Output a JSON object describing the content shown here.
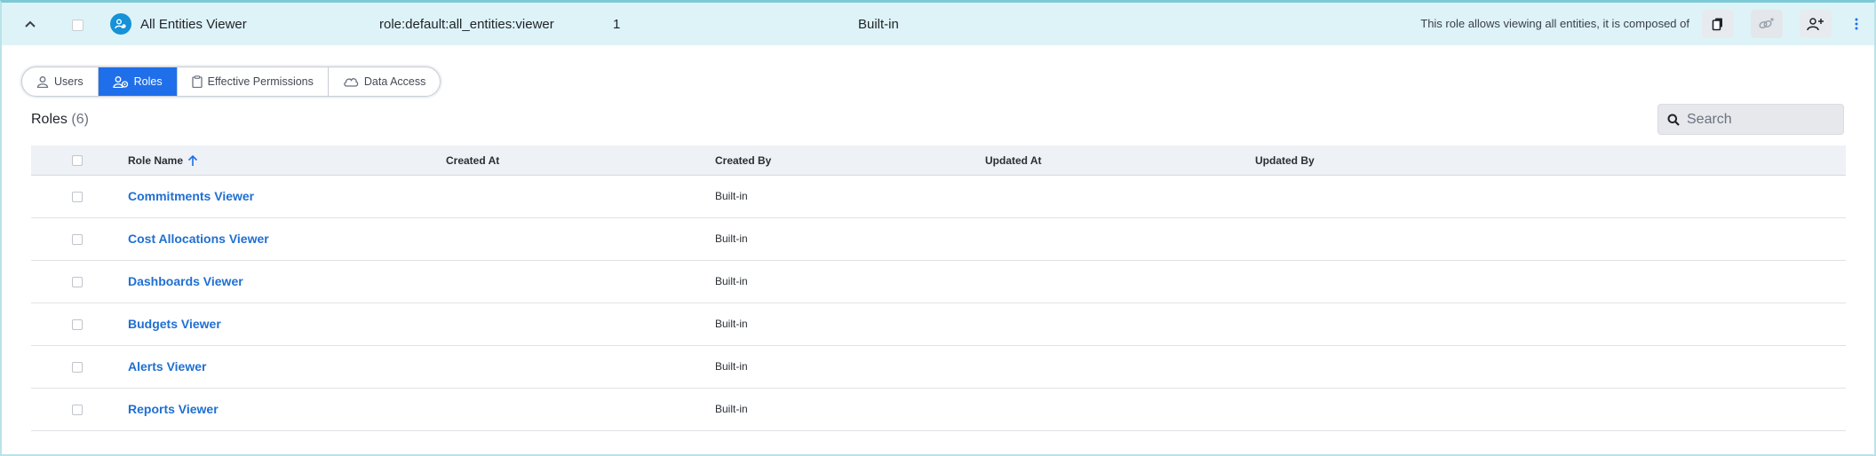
{
  "header": {
    "name": "All Entities Viewer",
    "key": "role:default:all_entities:viewer",
    "count": "1",
    "type": "Built-in",
    "description": "This role allows viewing all entities, it is composed of"
  },
  "tabs": [
    {
      "label": "Users",
      "icon": "user-icon",
      "active": false
    },
    {
      "label": "Roles",
      "icon": "roles-icon",
      "active": true
    },
    {
      "label": "Effective Permissions",
      "icon": "clipboard-icon",
      "active": false
    },
    {
      "label": "Data Access",
      "icon": "cloud-icon",
      "active": false
    }
  ],
  "section": {
    "title": "Roles",
    "count": "(6)"
  },
  "search": {
    "placeholder": "Search"
  },
  "table": {
    "columns": [
      "Role Name",
      "Created At",
      "Created By",
      "Updated At",
      "Updated By"
    ],
    "sort": {
      "column": "Role Name",
      "direction": "ascending"
    },
    "rows": [
      {
        "name": "Commitments Viewer",
        "created_by": "Built-in"
      },
      {
        "name": "Cost Allocations Viewer",
        "created_by": "Built-in"
      },
      {
        "name": "Dashboards Viewer",
        "created_by": "Built-in"
      },
      {
        "name": "Budgets Viewer",
        "created_by": "Built-in"
      },
      {
        "name": "Alerts Viewer",
        "created_by": "Built-in"
      },
      {
        "name": "Reports Viewer",
        "created_by": "Built-in"
      }
    ]
  },
  "colors": {
    "accent": "#1f6feb",
    "link": "#1f6fd1",
    "header_bg": "#def3f7",
    "avatar": "#1592d8"
  }
}
